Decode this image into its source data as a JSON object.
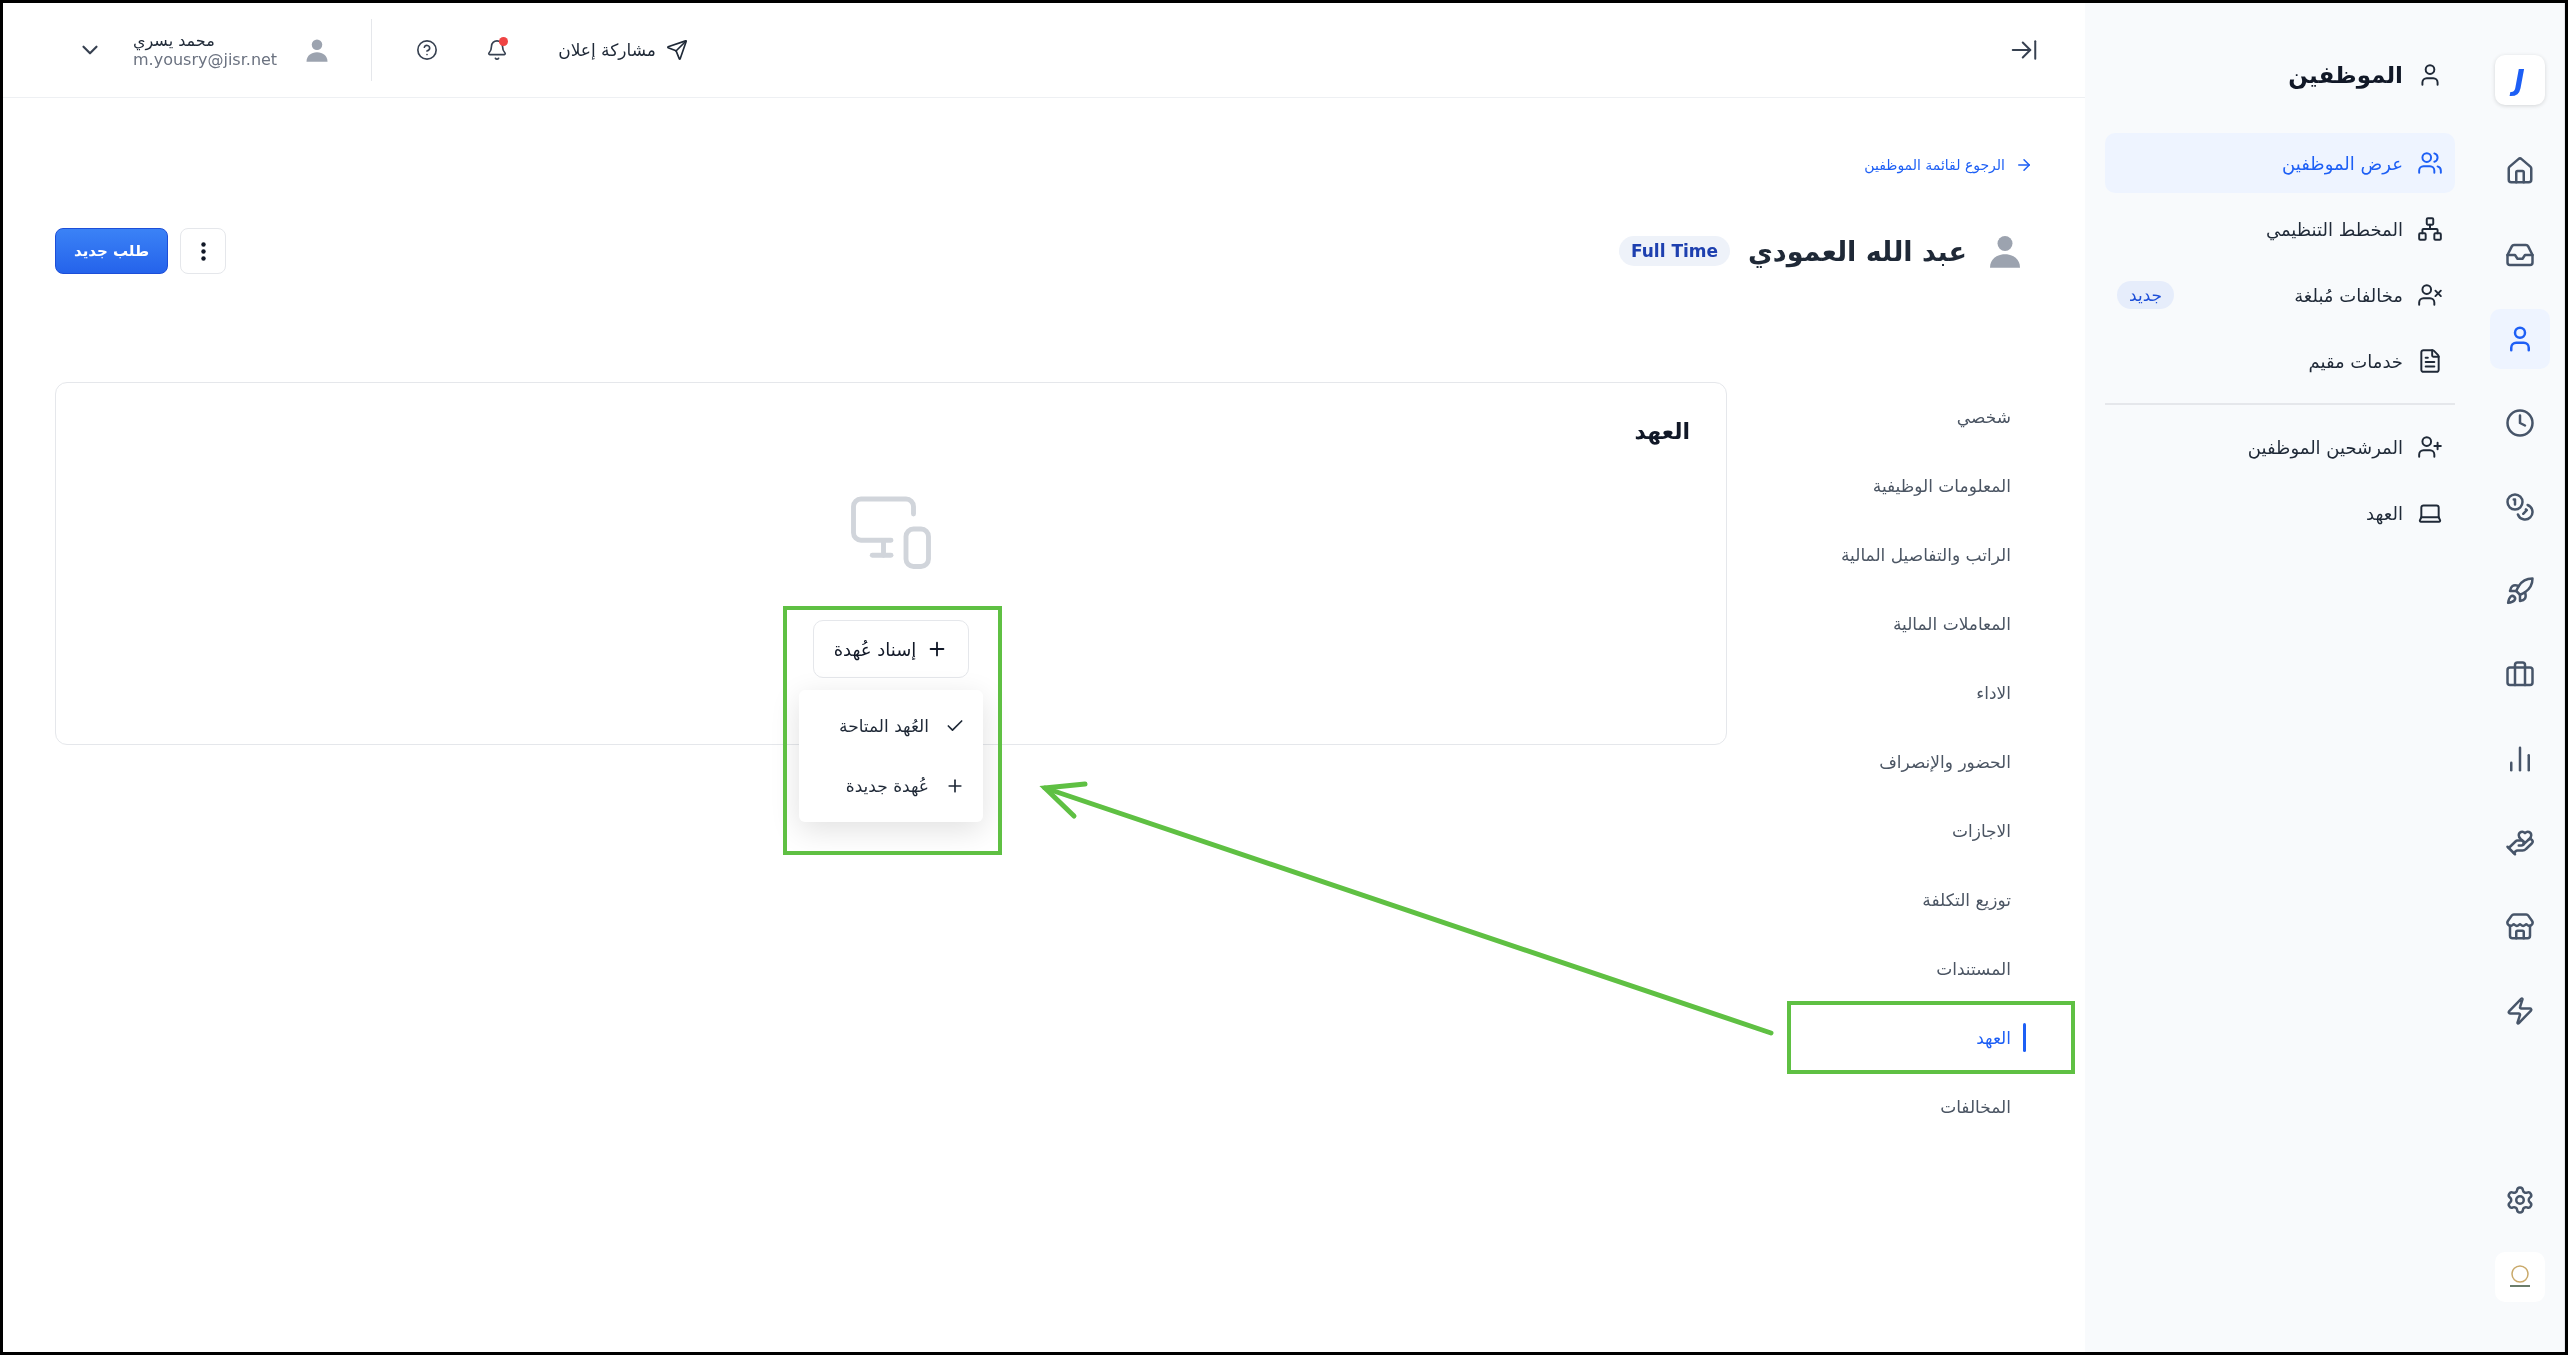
{
  "rail": {
    "logo": "J",
    "items": [
      {
        "selected": false
      },
      {
        "selected": false
      },
      {
        "selected": true
      },
      {
        "selected": false
      },
      {
        "selected": false
      },
      {
        "selected": false
      },
      {
        "selected": false
      },
      {
        "selected": false
      },
      {
        "selected": false
      },
      {
        "selected": false
      },
      {
        "selected": false
      }
    ]
  },
  "sidebar": {
    "title": "الموظفين",
    "items": [
      {
        "label": "عرض الموظفين",
        "selected": true
      },
      {
        "label": "المخطط التنظيمي",
        "selected": false
      },
      {
        "label": "مخالفات مُبلغة",
        "selected": false,
        "badge": "جديد"
      },
      {
        "label": "خدمات مقيم",
        "selected": false
      }
    ],
    "secondary_items": [
      {
        "label": "المرشحين الموظفين",
        "selected": false
      },
      {
        "label": "العهد",
        "selected": false
      }
    ]
  },
  "topbar": {
    "share_label": "مشاركة إعلان",
    "notification_unread": true,
    "user": {
      "name": "محمد يسري",
      "email": "m.yousry@jisr.net"
    }
  },
  "back_link": "الرجوع لقائمة الموظفين",
  "employee": {
    "name": "عبد الله العمودي",
    "badge": "Full Time"
  },
  "primary_action": "طلب جديد",
  "tabs": [
    {
      "label": "شخصي",
      "selected": false
    },
    {
      "label": "المعلومات الوظيفية",
      "selected": false
    },
    {
      "label": "الراتب والتفاصيل المالية",
      "selected": false
    },
    {
      "label": "المعاملات المالية",
      "selected": false
    },
    {
      "label": "الاداء",
      "selected": false
    },
    {
      "label": "الحضور والإنصراف",
      "selected": false
    },
    {
      "label": "الاجازات",
      "selected": false
    },
    {
      "label": "توزيع التكلفة",
      "selected": false
    },
    {
      "label": "المستندات",
      "selected": false
    },
    {
      "label": "العهد",
      "selected": true
    },
    {
      "label": "المخالفات",
      "selected": false
    }
  ],
  "card": {
    "title": "العهد",
    "assign_button": "إسناد عُهدة",
    "menu_open": true,
    "menu": [
      {
        "label": "العُهد المتاحة",
        "kind": "check"
      },
      {
        "label": "عُهدة جديدة",
        "kind": "add"
      }
    ]
  }
}
